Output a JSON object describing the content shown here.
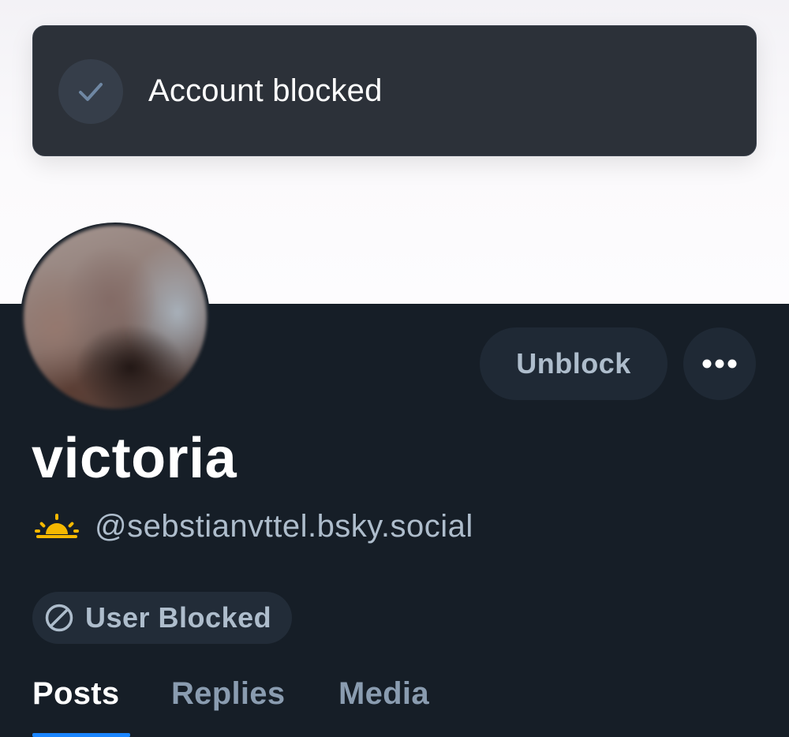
{
  "toast": {
    "message": "Account blocked",
    "icon": "check-icon"
  },
  "profile": {
    "display_name": "victoria",
    "handle_emoji": "sunrise-emoji",
    "handle": "@sebstianvttel.bsky.social",
    "avatar": "avatar-image"
  },
  "actions": {
    "unblock_label": "Unblock",
    "more_icon": "more-horizontal-icon"
  },
  "badge": {
    "label": "User Blocked",
    "icon": "blocked-icon"
  },
  "tabs": [
    {
      "label": "Posts",
      "active": true
    },
    {
      "label": "Replies",
      "active": false
    },
    {
      "label": "Media",
      "active": false
    }
  ],
  "colors": {
    "background": "#161e27",
    "toast_bg": "#2c3139",
    "accent": "#1a85ff",
    "muted_text": "#aebdcc",
    "sun": "#f5b800"
  }
}
